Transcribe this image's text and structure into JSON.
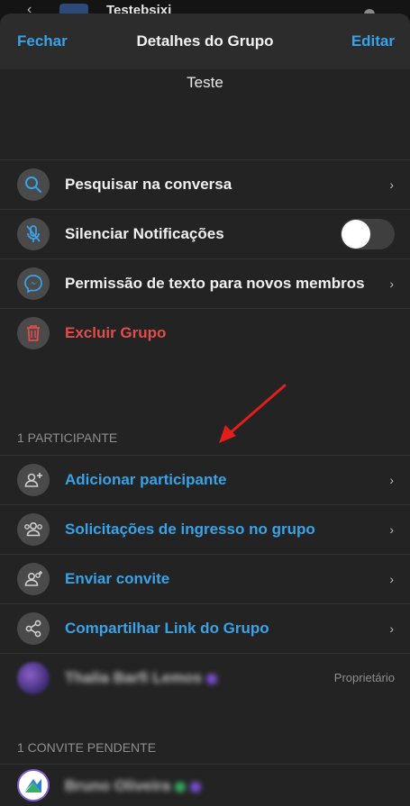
{
  "behind": {
    "title": "Testebsixi"
  },
  "header": {
    "left": "Fechar",
    "title": "Detalhes do Grupo",
    "right": "Editar"
  },
  "group": {
    "name": "Teste"
  },
  "actions": [
    {
      "label": "Pesquisar na conversa",
      "icon": "search-icon",
      "style": "white",
      "trailing": "chevron"
    },
    {
      "label": "Silenciar Notificações",
      "icon": "mic-off-icon",
      "style": "white",
      "trailing": "toggle",
      "toggle_on": false
    },
    {
      "label": "Permissão de texto para novos membros",
      "icon": "messenger-icon",
      "style": "white",
      "trailing": "chevron"
    },
    {
      "label": "Excluir Grupo",
      "icon": "trash-icon",
      "style": "red",
      "trailing": "none"
    }
  ],
  "participants_header": "1 PARTICIPANTE",
  "participant_actions": [
    {
      "label": "Adicionar participante",
      "icon": "add-person-icon"
    },
    {
      "label": "Solicitações de ingresso no grupo",
      "icon": "people-icon"
    },
    {
      "label": "Enviar convite",
      "icon": "invite-icon"
    },
    {
      "label": "Compartilhar Link do Grupo",
      "icon": "share-icon"
    }
  ],
  "member": {
    "name": "Thalia Barfi Lemos",
    "role": "Proprietário"
  },
  "pending_header": "1 CONVITE PENDENTE",
  "pending": {
    "name": "Bruno Oliveira"
  },
  "colors": {
    "accent": "#3aa2e6",
    "danger": "#e24c4c",
    "background": "#232323",
    "annotation_arrow": "#e01e1e"
  }
}
